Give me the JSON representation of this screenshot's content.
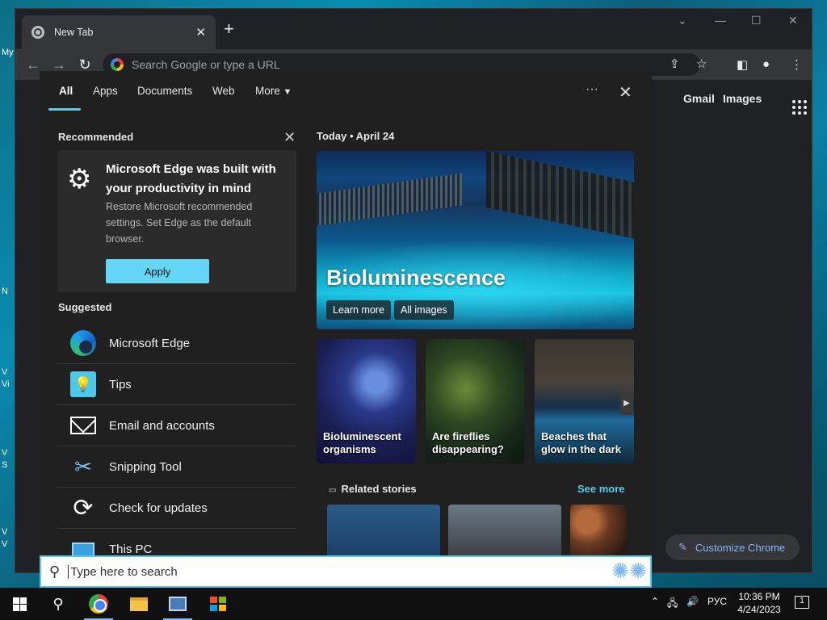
{
  "desktop": {
    "left_labels": [
      "My",
      "N",
      "V",
      "Vi",
      "V",
      "S",
      "V",
      "V"
    ]
  },
  "browser": {
    "tab_title": "New Tab",
    "omnibox_placeholder": "Search Google or type a URL",
    "new_tab_symbol": "+",
    "google_links": {
      "gmail": "Gmail",
      "images": "Images"
    },
    "customize_label": "Customize Chrome"
  },
  "search_panel": {
    "tabs": [
      {
        "label": "All",
        "active": true
      },
      {
        "label": "Apps"
      },
      {
        "label": "Documents"
      },
      {
        "label": "Web"
      },
      {
        "label": "More"
      }
    ],
    "more_options_symbol": "···",
    "recommended": {
      "heading": "Recommended",
      "card_title": "Microsoft Edge was built with your productivity in mind",
      "card_description": "Restore Microsoft recommended settings. Set Edge as the default browser.",
      "apply_label": "Apply"
    },
    "suggested": {
      "heading": "Suggested",
      "items": [
        {
          "label": "Microsoft Edge",
          "icon": "edge-icon"
        },
        {
          "label": "Tips",
          "icon": "tips-icon"
        },
        {
          "label": "Email and accounts",
          "icon": "mail-icon"
        },
        {
          "label": "Snipping Tool",
          "icon": "snipping-tool-icon"
        },
        {
          "label": "Check for updates",
          "icon": "update-icon"
        },
        {
          "label": "This PC",
          "icon": "this-pc-icon"
        }
      ]
    },
    "today": {
      "label": "Today",
      "date": "April 24",
      "hero_title": "Bioluminescence",
      "learn_more": "Learn more",
      "all_images": "All images",
      "thumbnails": [
        {
          "caption": "Bioluminescent organisms"
        },
        {
          "caption": "Are fireflies disappearing?"
        },
        {
          "caption": "Beaches that glow in the dark"
        }
      ],
      "related_heading": "Related stories",
      "see_more": "See more"
    }
  },
  "search_box": {
    "placeholder": "Type here to search"
  },
  "taskbar": {
    "language": "РУС",
    "time": "10:36 PM",
    "date": "4/24/2023",
    "notification_count": "1"
  },
  "colors": {
    "accent": "#5ccbe8",
    "chrome_bg": "#202124",
    "panel_bg": "#202020",
    "link": "#8ab4f8"
  }
}
